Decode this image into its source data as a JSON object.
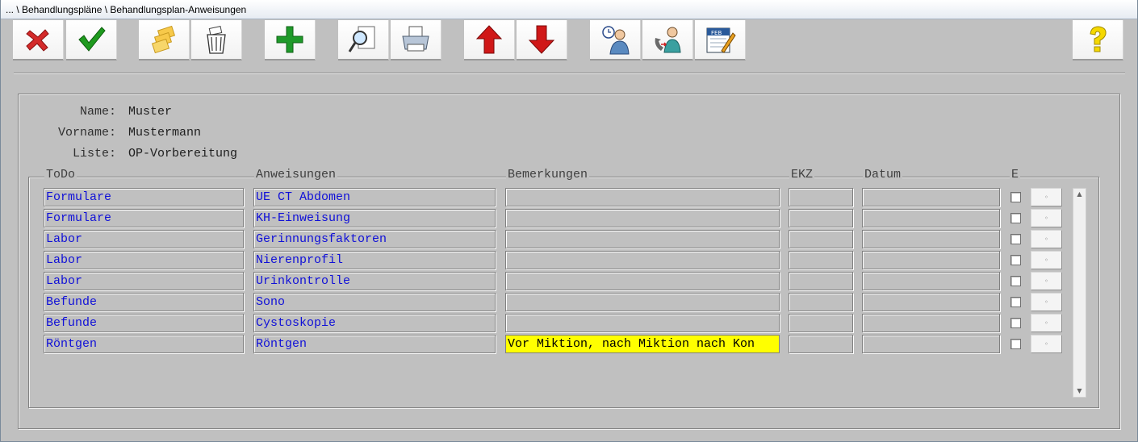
{
  "window": {
    "title": "... \\ Behandlungspläne \\ Behandlungsplan-Anweisungen"
  },
  "toolbar": {
    "buttons": [
      {
        "name": "cancel",
        "icon": "red-x-icon"
      },
      {
        "name": "confirm",
        "icon": "green-check-icon"
      },
      {
        "name": "open",
        "icon": "folder-stack-icon"
      },
      {
        "name": "delete",
        "icon": "trash-bin-icon"
      },
      {
        "name": "add",
        "icon": "green-plus-icon"
      },
      {
        "name": "preview",
        "icon": "magnifier-document-icon"
      },
      {
        "name": "print",
        "icon": "printer-icon"
      },
      {
        "name": "move-up",
        "icon": "red-arrow-up-icon"
      },
      {
        "name": "move-down",
        "icon": "red-arrow-down-icon"
      },
      {
        "name": "appointment",
        "icon": "person-clock-icon"
      },
      {
        "name": "phone",
        "icon": "person-phone-icon"
      },
      {
        "name": "calendar",
        "icon": "calendar-edit-icon"
      },
      {
        "name": "help",
        "icon": "question-mark-icon"
      }
    ],
    "calendar_month": "FEB"
  },
  "patient": {
    "name_label": "Name:",
    "name": "Muster",
    "vorname_label": "Vorname:",
    "vorname": "Mustermann",
    "liste_label": "Liste:",
    "liste": "OP-Vorbereitung"
  },
  "table": {
    "headers": {
      "todo": "ToDo",
      "anweisungen": "Anweisungen",
      "bemerkungen": "Bemerkungen",
      "ekz": "EKZ",
      "datum": "Datum",
      "e": "E"
    },
    "rows": [
      {
        "todo": "Formulare",
        "anweisung": "UE CT Abdomen",
        "bemerkung": "",
        "ekz": "",
        "datum": "",
        "e": false
      },
      {
        "todo": "Formulare",
        "anweisung": "KH-Einweisung",
        "bemerkung": "",
        "ekz": "",
        "datum": "",
        "e": false
      },
      {
        "todo": "Labor",
        "anweisung": "Gerinnungsfaktoren",
        "bemerkung": "",
        "ekz": "",
        "datum": "",
        "e": false
      },
      {
        "todo": "Labor",
        "anweisung": "Nierenprofil",
        "bemerkung": "",
        "ekz": "",
        "datum": "",
        "e": false
      },
      {
        "todo": "Labor",
        "anweisung": "Urinkontrolle",
        "bemerkung": "",
        "ekz": "",
        "datum": "",
        "e": false
      },
      {
        "todo": "Befunde",
        "anweisung": "Sono",
        "bemerkung": "",
        "ekz": "",
        "datum": "",
        "e": false
      },
      {
        "todo": "Befunde",
        "anweisung": "Cystoskopie",
        "bemerkung": "",
        "ekz": "",
        "datum": "",
        "e": false
      },
      {
        "todo": "Röntgen",
        "anweisung": "Röntgen",
        "bemerkung": "Vor Miktion, nach Miktion nach Kon",
        "ekz": "",
        "datum": "",
        "e": false
      }
    ]
  },
  "colors": {
    "background": "#c0c0c0",
    "link_text": "#1010d8",
    "highlight": "#ffff00"
  }
}
